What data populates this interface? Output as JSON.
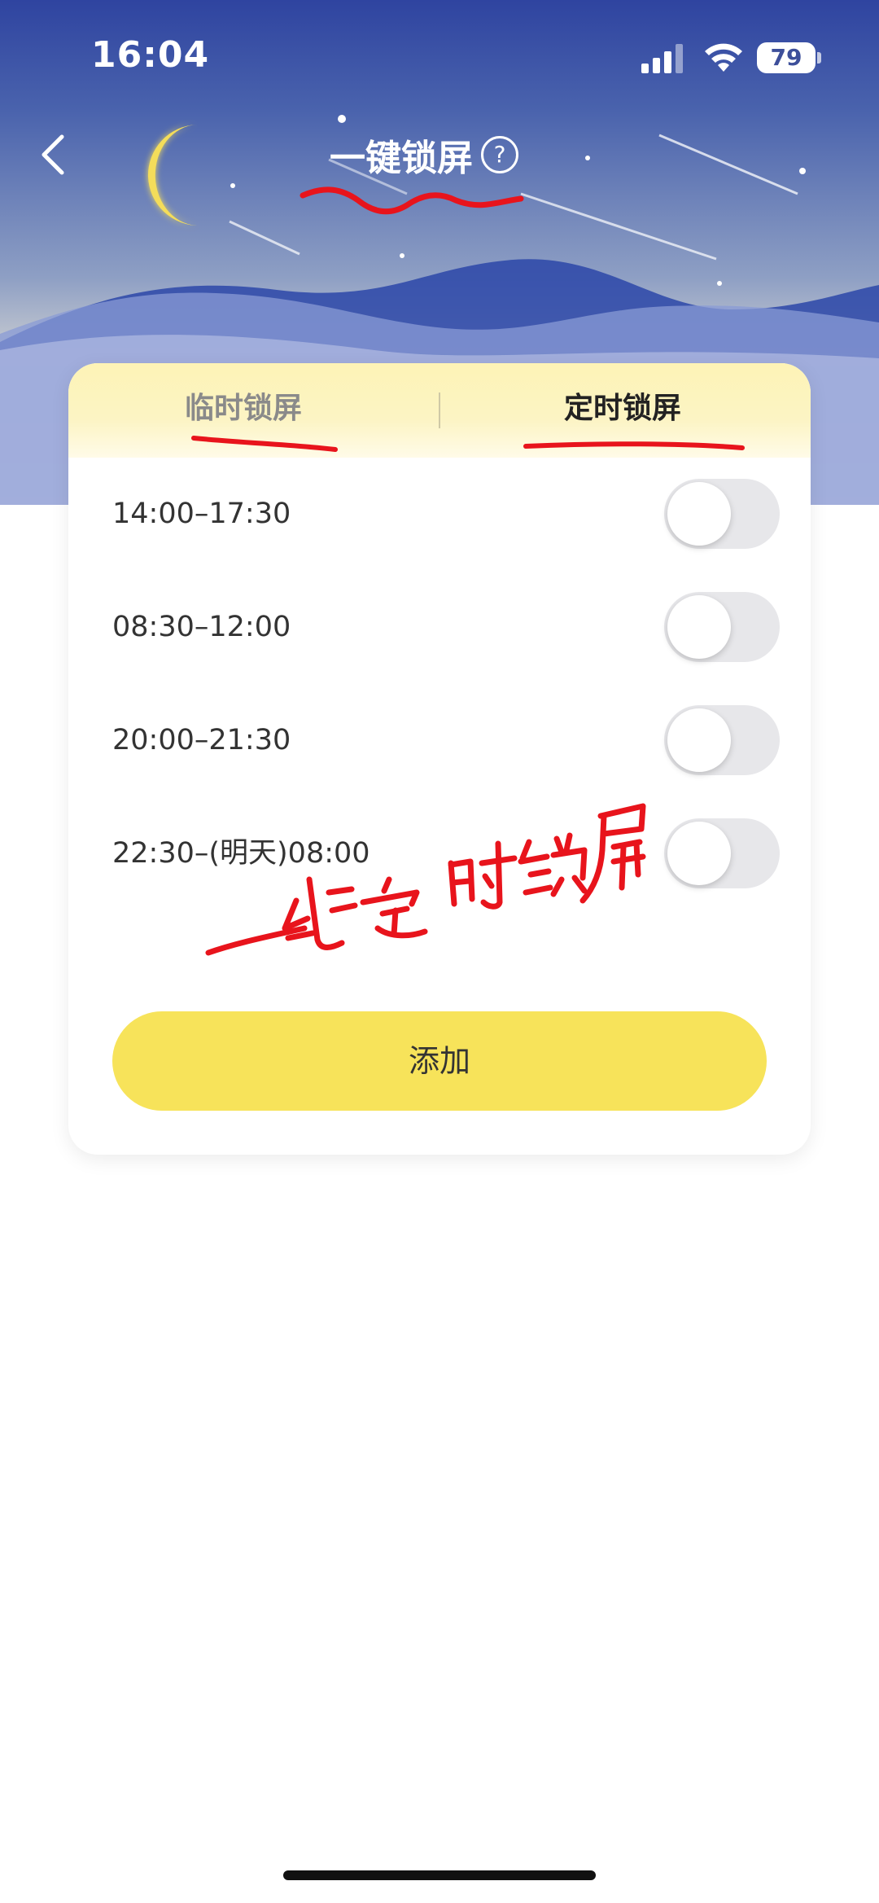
{
  "status_bar": {
    "time": "16:04",
    "battery": "79"
  },
  "header": {
    "title": "一键锁屏",
    "help_glyph": "?"
  },
  "tabs": [
    {
      "label": "临时锁屏",
      "active": false
    },
    {
      "label": "定时锁屏",
      "active": true
    }
  ],
  "schedules": [
    {
      "label": "14:00–17:30",
      "enabled": false
    },
    {
      "label": "08:30–12:00",
      "enabled": false
    },
    {
      "label": "20:00–21:30",
      "enabled": false
    },
    {
      "label": "22:30–(明天)08:00",
      "enabled": false
    }
  ],
  "add_button": {
    "label": "添加"
  },
  "annotation": {
    "handwritten_text": "一键定时锁屏",
    "color": "#e8141c"
  },
  "colors": {
    "accent_yellow": "#f7e35a",
    "header_blue": "#2f44a0",
    "moon": "#f4dd5a"
  },
  "icons": {
    "back": "chevron-left-icon",
    "help": "question-circle-icon",
    "signal": "cellular-signal-icon",
    "wifi": "wifi-icon",
    "battery": "battery-icon",
    "moon": "crescent-moon-icon"
  }
}
